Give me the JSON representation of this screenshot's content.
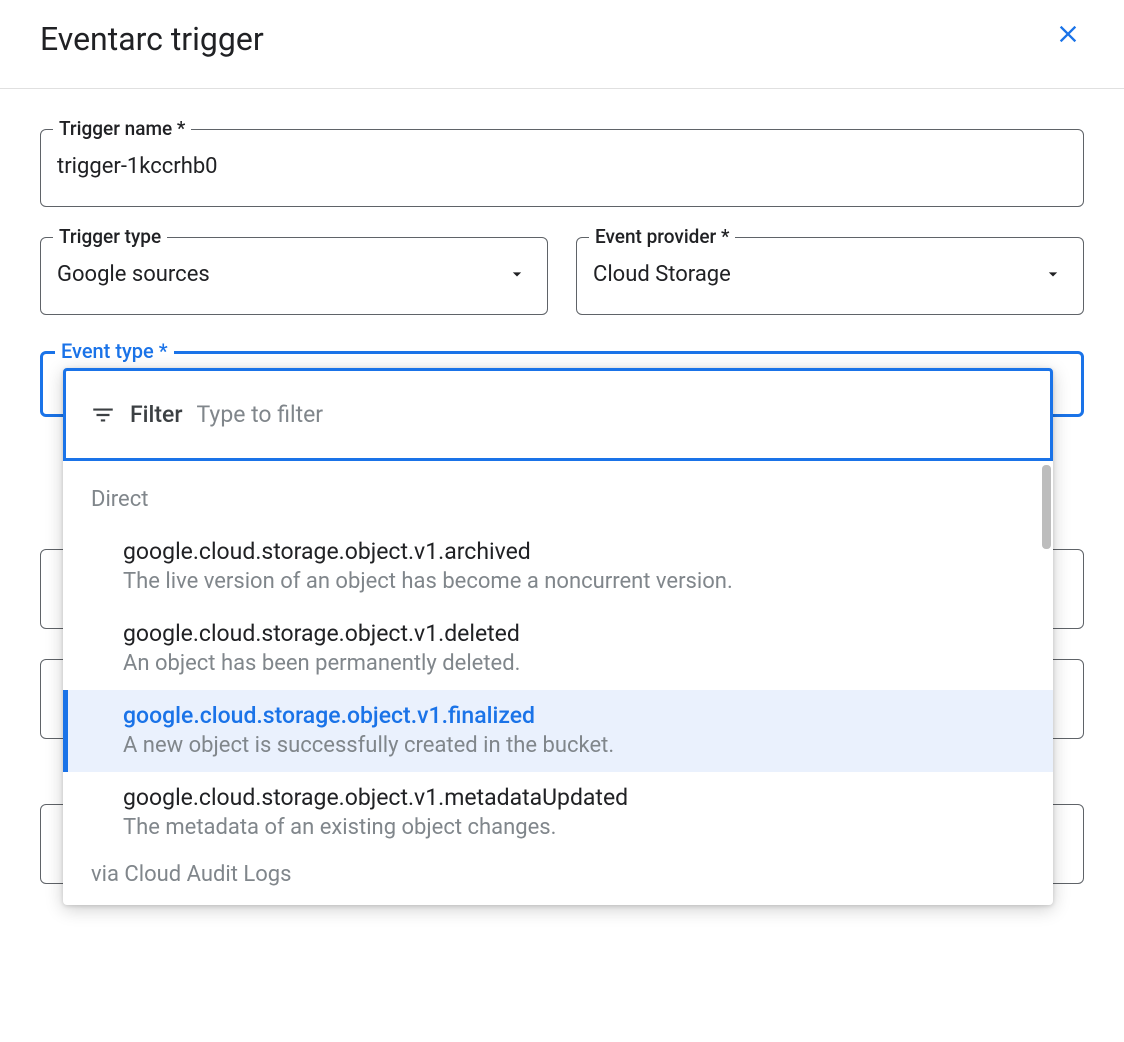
{
  "header": {
    "title": "Eventarc trigger"
  },
  "fields": {
    "trigger_name": {
      "label": "Trigger name *",
      "value": "trigger-1kccrhb0"
    },
    "trigger_type": {
      "label": "Trigger type",
      "value": "Google sources"
    },
    "event_provider": {
      "label": "Event provider *",
      "value": "Cloud Storage"
    },
    "event_type": {
      "label": "Event type *",
      "filter_label": "Filter",
      "filter_placeholder": "Type to filter"
    }
  },
  "dropdown": {
    "group_direct": "Direct",
    "group_audit": "via Cloud Audit Logs",
    "options": [
      {
        "title": "google.cloud.storage.object.v1.archived",
        "desc": "The live version of an object has become a noncurrent version."
      },
      {
        "title": "google.cloud.storage.object.v1.deleted",
        "desc": "An object has been permanently deleted."
      },
      {
        "title": "google.cloud.storage.object.v1.finalized",
        "desc": "A new object is successfully created in the bucket."
      },
      {
        "title": "google.cloud.storage.object.v1.metadataUpdated",
        "desc": "The metadata of an existing object changes."
      }
    ]
  }
}
